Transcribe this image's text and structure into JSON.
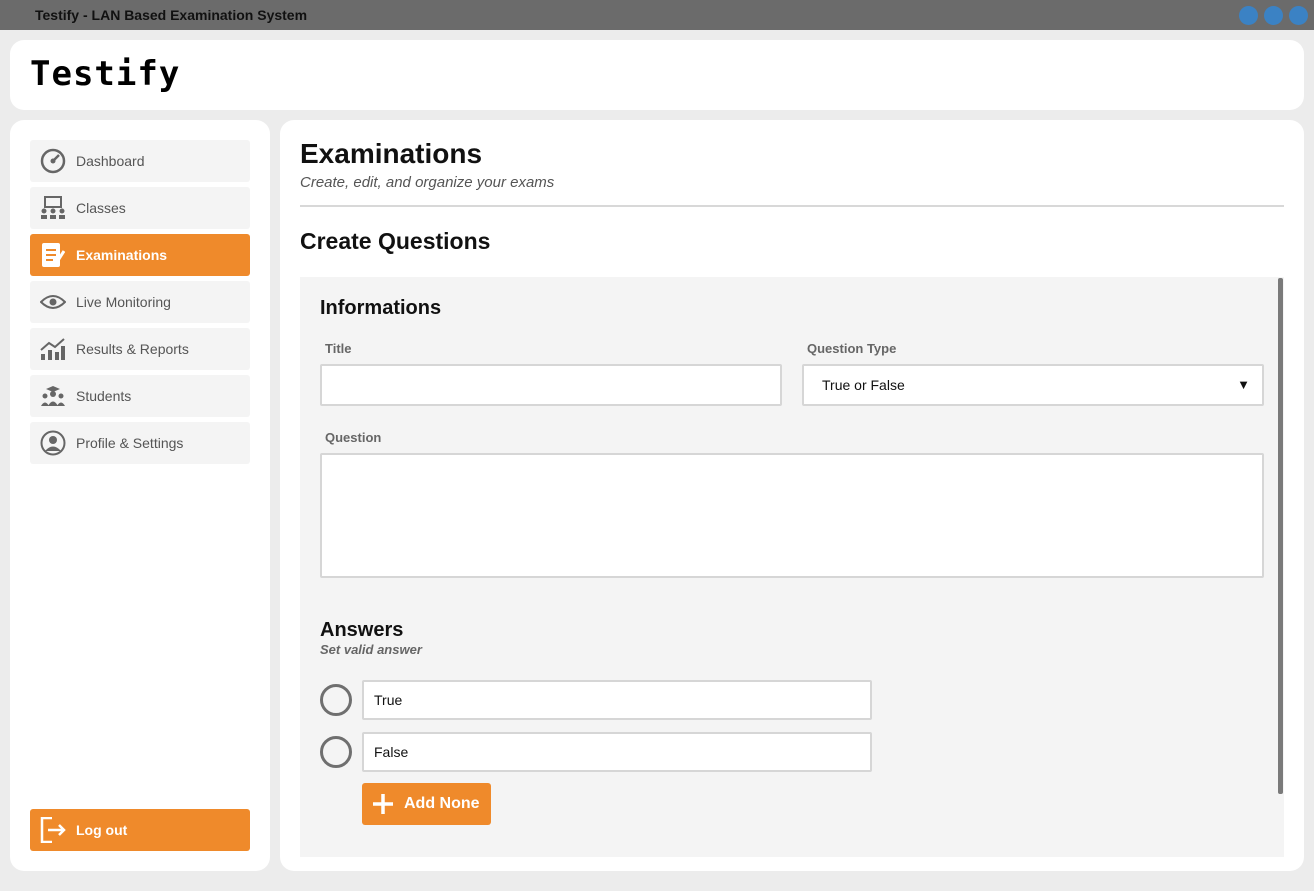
{
  "window": {
    "title": "Testify - LAN Based Examination System",
    "control_color": "#3b82c4"
  },
  "brand": {
    "logo_text": "Testify"
  },
  "sidebar": {
    "items": [
      {
        "label": "Dashboard",
        "icon": "speedometer-icon",
        "active": false
      },
      {
        "label": "Classes",
        "icon": "classroom-icon",
        "active": false
      },
      {
        "label": "Examinations",
        "icon": "exam-paper-icon",
        "active": true
      },
      {
        "label": "Live Monitoring",
        "icon": "eye-icon",
        "active": false
      },
      {
        "label": "Results & Reports",
        "icon": "chart-trend-icon",
        "active": false
      },
      {
        "label": "Students",
        "icon": "students-icon",
        "active": false
      },
      {
        "label": "Profile & Settings",
        "icon": "user-circle-icon",
        "active": false
      }
    ],
    "logout_label": "Log out",
    "accent": "#ef8a2b"
  },
  "main": {
    "title": "Examinations",
    "subtitle": "Create, edit, and organize your exams",
    "section_title": "Create Questions",
    "informations": {
      "heading": "Informations",
      "title_label": "Title",
      "title_value": "",
      "question_type_label": "Question Type",
      "question_type_value": "True or False",
      "question_label": "Question",
      "question_value": ""
    },
    "answers": {
      "heading": "Answers",
      "subtitle": "Set valid answer",
      "options": [
        {
          "value": "True",
          "selected": false
        },
        {
          "value": "False",
          "selected": false
        }
      ],
      "add_button_label": "Add None"
    }
  }
}
